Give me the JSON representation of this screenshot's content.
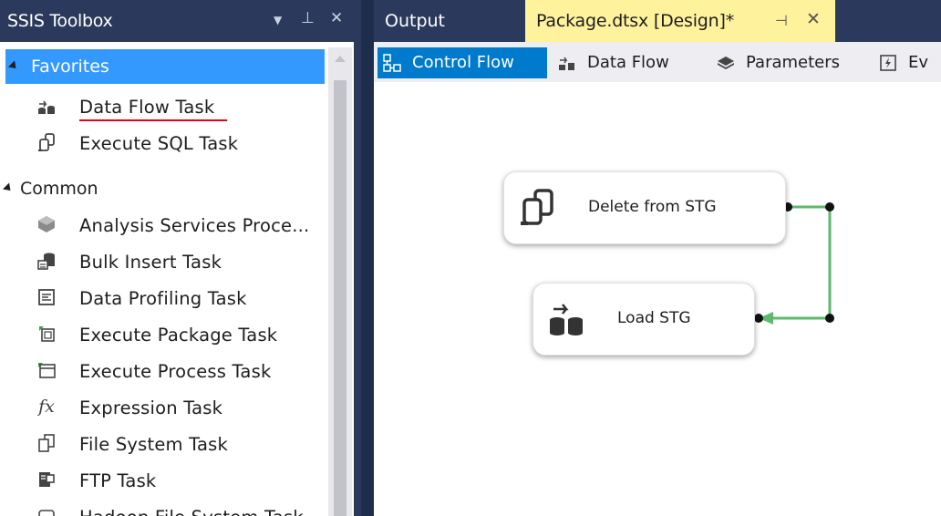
{
  "toolbox": {
    "title": "SSIS Toolbox",
    "controls": {
      "dropdown": "▼",
      "pin": "⊥",
      "close": "✕"
    },
    "groups": {
      "favorites": {
        "label": "Favorites",
        "items": [
          {
            "label": "Data Flow Task",
            "icon": "data-flow-task-icon"
          },
          {
            "label": "Execute SQL Task",
            "icon": "execute-sql-task-icon"
          }
        ]
      },
      "common": {
        "label": "Common",
        "items": [
          {
            "label": "Analysis Services Proce...",
            "icon": "analysis-services-icon"
          },
          {
            "label": "Bulk Insert Task",
            "icon": "bulk-insert-icon"
          },
          {
            "label": "Data Profiling Task",
            "icon": "data-profiling-icon"
          },
          {
            "label": "Execute Package Task",
            "icon": "execute-package-icon"
          },
          {
            "label": "Execute Process Task",
            "icon": "execute-process-icon"
          },
          {
            "label": "Expression Task",
            "icon": "expression-icon",
            "glyph": "fx"
          },
          {
            "label": "File System Task",
            "icon": "file-system-icon"
          },
          {
            "label": "FTP Task",
            "icon": "ftp-icon"
          },
          {
            "label": "Hadoop File System Task",
            "icon": "hadoop-icon"
          }
        ]
      }
    }
  },
  "tabs": {
    "output": "Output",
    "package": "Package.dtsx [Design]*",
    "package_pin": "⊣",
    "package_close": "✕"
  },
  "design_tabs": [
    {
      "label": "Control Flow",
      "icon": "control-flow-icon",
      "active": true
    },
    {
      "label": "Data Flow",
      "icon": "data-flow-icon",
      "active": false
    },
    {
      "label": "Parameters",
      "icon": "parameters-icon",
      "active": false
    },
    {
      "label": "Ev",
      "icon": "event-handlers-icon",
      "active": false
    }
  ],
  "canvas": {
    "tasks": [
      {
        "label": "Delete from STG",
        "icon": "execute-sql-task-icon"
      },
      {
        "label": "Load STG",
        "icon": "data-flow-task-icon"
      }
    ],
    "connector_color": "#5dba6d"
  },
  "colors": {
    "chrome": "#2b3a5c",
    "selection": "#3399ff",
    "active_tab": "#007acc",
    "document_tab": "#fff29d",
    "underline": "#e8001c"
  }
}
